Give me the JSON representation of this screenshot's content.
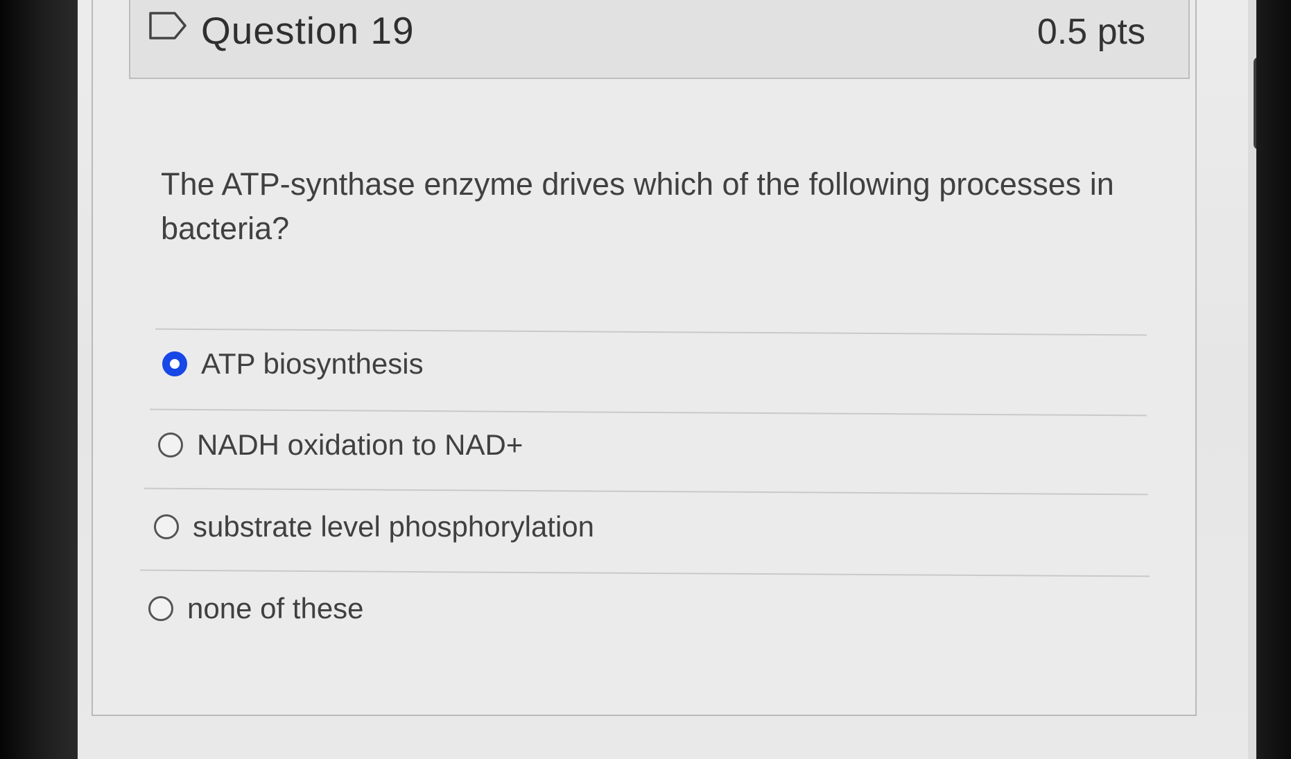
{
  "question": {
    "title": "Question 19",
    "points": "0.5 pts",
    "flag_icon": "flag-icon",
    "prompt": "The ATP-synthase enzyme drives which of the following processes in bacteria?"
  },
  "answers": [
    {
      "label": "ATP biosynthesis",
      "selected": true
    },
    {
      "label": "NADH oxidation to NAD+",
      "selected": false
    },
    {
      "label": "substrate level phosphorylation",
      "selected": false
    },
    {
      "label": "none of these",
      "selected": false
    }
  ],
  "colors": {
    "selected_radio": "#1747e6",
    "page_background": "#ebebeb",
    "header_background": "#e1e1e1"
  }
}
